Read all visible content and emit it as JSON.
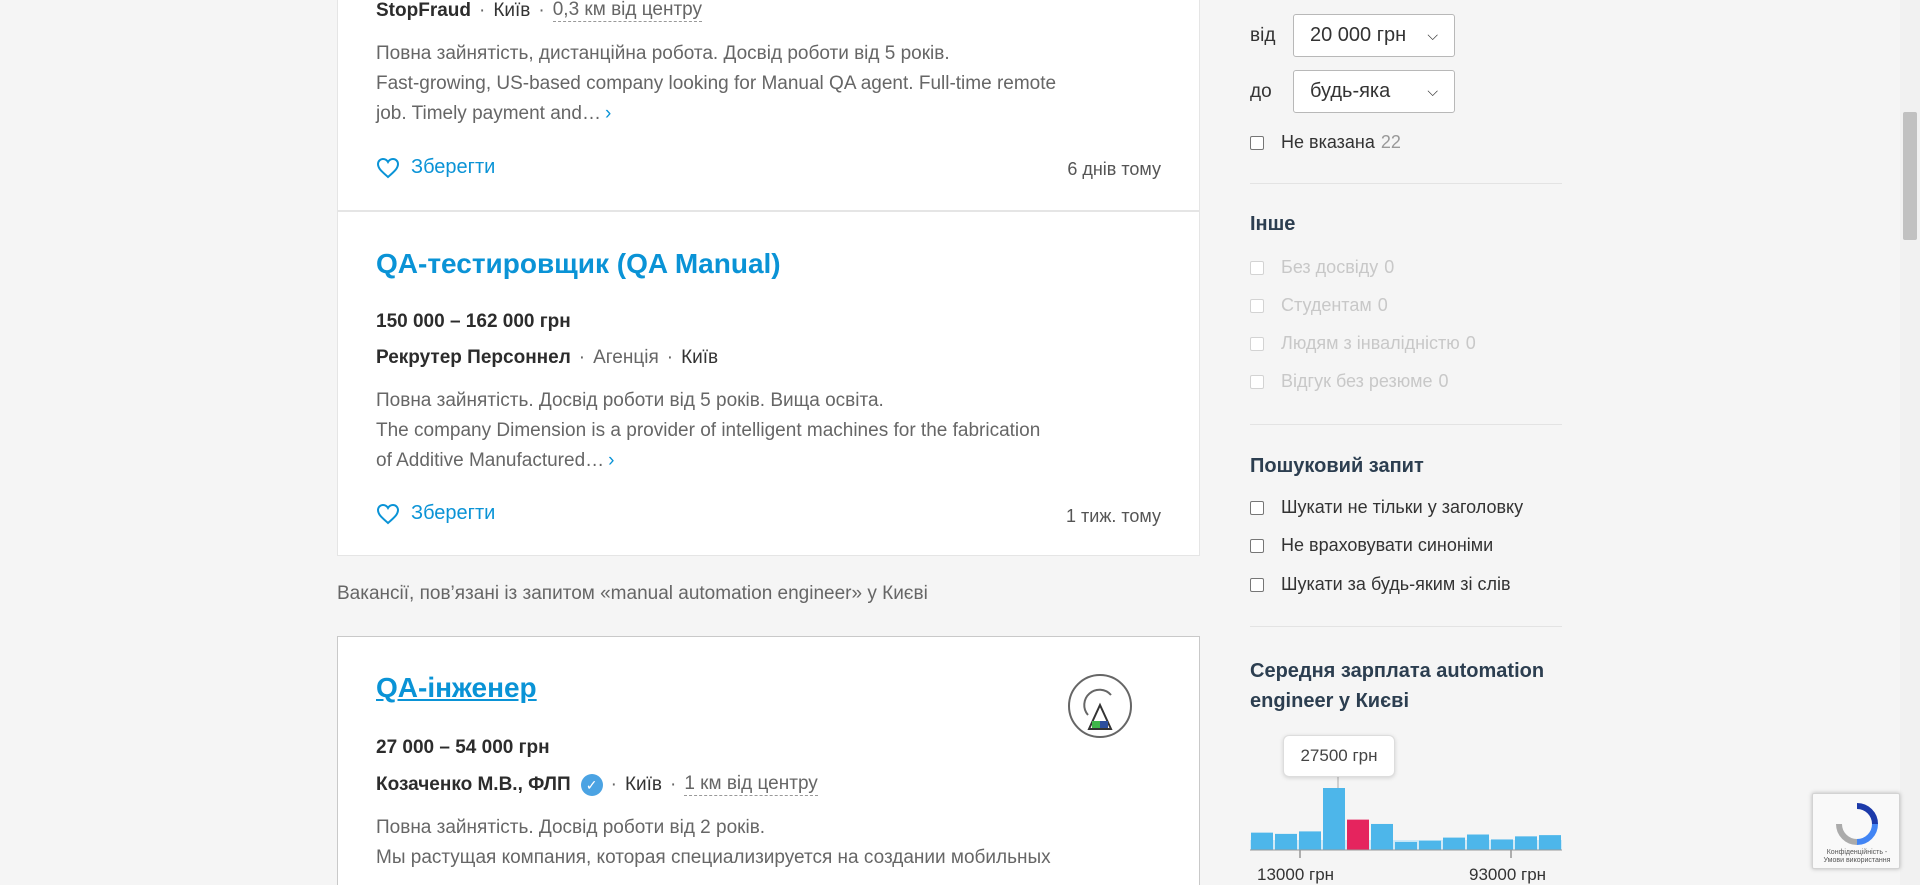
{
  "jobs": [
    {
      "company": "StopFraud",
      "city": "Київ",
      "distance": "0,3 км від центру",
      "desc_line1": "Повна зайнятість, дистанційна робота. Досвід роботи від 5 років.",
      "desc_line2": "Fast-growing, US-based company looking for Manual QA agent. Full-time remote",
      "desc_line3": "job. Timely payment and…",
      "more": "›",
      "save_label": "Зберегти",
      "posted": "6 днів тому"
    },
    {
      "title": "QA-тестировщик (QA Manual)",
      "salary": "150 000 – 162 000 грн",
      "company": "Рекрутер Персоннел",
      "type": "Агенція",
      "city": "Київ",
      "desc_line1": "Повна зайнятість. Досвід роботи від 5 років. Вища освіта.",
      "desc_line2": "The company Dimension is a provider of intelligent machines for the fabrication",
      "desc_line3": "of Additive Manufactured…",
      "more": "›",
      "save_label": "Зберегти",
      "posted": "1 тиж. тому"
    },
    {
      "title": "QA-інженер",
      "salary": "27 000 – 54 000 грн",
      "company": "Козаченко М.В., ФЛП",
      "city": "Київ",
      "distance": "1 км від центру",
      "desc_line1": "Повна зайнятість. Досвід роботи від 2 років.",
      "desc_line2": "Мы растущая компания, которая специализируется на создании мобильных"
    }
  ],
  "related_text": "Вакансії, пов’язані із запитом «manual automation engineer» у Києві",
  "sidebar": {
    "salary_from_label": "від",
    "salary_from_value": "20 000 грн",
    "salary_to_label": "до",
    "salary_to_value": "будь-яка",
    "not_specified_label": "Не вказана",
    "not_specified_count": "22",
    "other_title": "Інше",
    "other_items": [
      {
        "label": "Без досвіду",
        "count": "0"
      },
      {
        "label": "Студентам",
        "count": "0"
      },
      {
        "label": "Людям з інвалідністю",
        "count": "0"
      },
      {
        "label": "Відгук без резюме",
        "count": "0"
      }
    ],
    "search_title": "Пошуковий запит",
    "search_items": [
      {
        "label": "Шукати не тільки у заголовку"
      },
      {
        "label": "Не враховувати синоніми"
      },
      {
        "label": "Шукати за будь-яким зі слів"
      }
    ],
    "avg_title": "Середня зарплата automation engineer у Києві",
    "tooltip": "27500 грн",
    "axis_min": "13000 грн",
    "axis_max": "93000 грн"
  },
  "histogram": {
    "values": [
      0.28,
      0.26,
      0.3,
      1.0,
      0.49,
      0.42,
      0.13,
      0.15,
      0.2,
      0.25,
      0.17,
      0.22,
      0.24
    ],
    "highlight_index": 4,
    "color": "#4db6ea",
    "highlight_color": "#e5245e"
  },
  "colors": {
    "accent": "#0a93d6",
    "verified": "#4ba3e3"
  },
  "recaptcha_text": "Конфіденційність - Умови використання"
}
